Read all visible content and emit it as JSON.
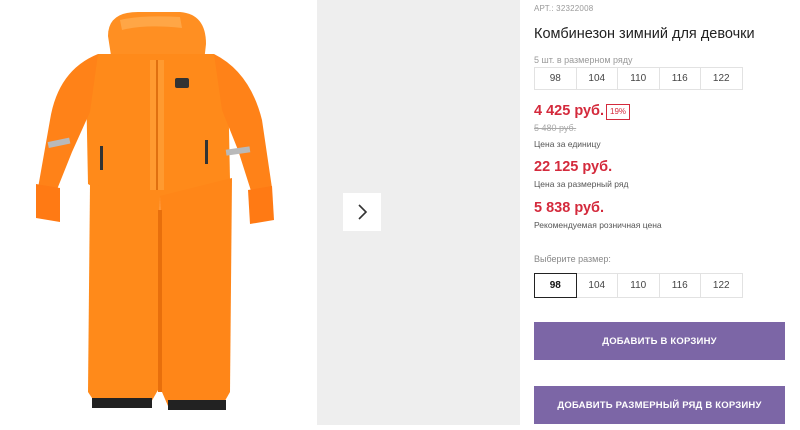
{
  "product": {
    "article": "АРТ.: 32322008",
    "title": "Комбинезон зимний для девочки",
    "pack_note": "5 шт. в размерном ряду",
    "pack_sizes": [
      "98",
      "104",
      "110",
      "116",
      "122"
    ],
    "price": "4 425 руб.",
    "discount": "19%",
    "old_price": "5 480 руб.",
    "price_caption": "Цена за единицу",
    "pack_price": "22 125 руб.",
    "pack_price_caption": "Цена за размерный ряд",
    "retail_price": "5 838 руб.",
    "retail_price_caption": "Рекомендуемая розничная цена",
    "choose_size_label": "Выберите размер:",
    "sizes": [
      "98",
      "104",
      "110",
      "116",
      "122"
    ],
    "selected_size": "98",
    "add_to_cart": "ДОБАВИТЬ В КОРЗИНУ",
    "add_pack_to_cart": "ДОБАВИТЬ РАЗМЕРНЫЙ РЯД В КОРЗИНУ"
  },
  "gallery": {
    "main_image": "orange-winter-jumpsuit",
    "next_icon": "chevron-right-icon"
  },
  "colors": {
    "price": "#d42a3c",
    "button": "#7c66a6",
    "jumpsuit": "#ff8a1a"
  }
}
